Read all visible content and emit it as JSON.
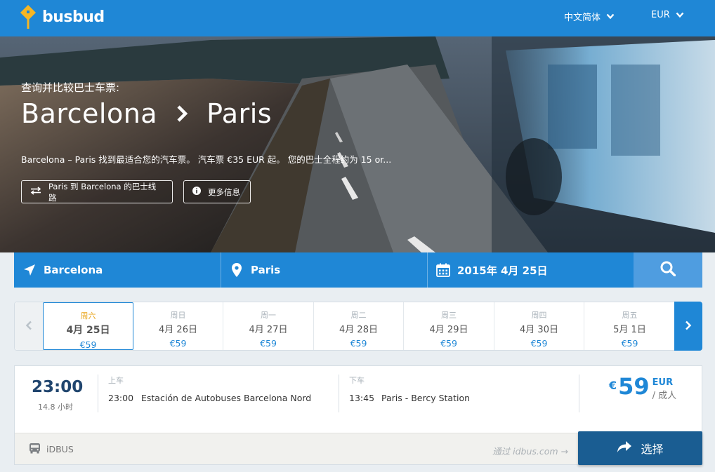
{
  "brand": {
    "name": "busbud",
    "pin_color": "#f6b624"
  },
  "nav": {
    "language": "中文简体",
    "currency": "EUR"
  },
  "hero": {
    "subtitle": "查询并比较巴士车票:",
    "origin": "Barcelona",
    "destination": "Paris",
    "description": "Barcelona – Paris 找到最适合您的汽车票。 汽车票 €35 EUR 起。 您的巴士全程约为 15 or...",
    "reverse_route_label": "Paris 到 Barcelona 的巴士线路",
    "more_info_label": "更多信息"
  },
  "search": {
    "origin": "Barcelona",
    "destination": "Paris",
    "date": "2015年 4月 25日",
    "accent": "#1f87d6"
  },
  "dates": [
    {
      "dow": "周六",
      "date": "4月 25日",
      "price": "€59",
      "active": true
    },
    {
      "dow": "周日",
      "date": "4月 26日",
      "price": "€59",
      "active": false
    },
    {
      "dow": "周一",
      "date": "4月 27日",
      "price": "€59",
      "active": false
    },
    {
      "dow": "周二",
      "date": "4月 28日",
      "price": "€59",
      "active": false
    },
    {
      "dow": "周三",
      "date": "4月 29日",
      "price": "€59",
      "active": false
    },
    {
      "dow": "周四",
      "date": "4月 30日",
      "price": "€59",
      "active": false
    },
    {
      "dow": "周五",
      "date": "5月 1日",
      "price": "€59",
      "active": false
    }
  ],
  "result": {
    "departure_time": "23:00",
    "duration": "14.8 小时",
    "boarding_label": "上车",
    "boarding_time": "23:00",
    "boarding_place": "Estación de Autobuses Barcelona Nord",
    "alighting_label": "下车",
    "alighting_time": "13:45",
    "alighting_place": "Paris - Bercy Station",
    "price_currency_symbol": "€",
    "price_amount": "59",
    "price_currency": "EUR",
    "price_per": "/ 成人",
    "operator": "iDBUS",
    "via": "通过 idbus.com →",
    "select_label": "选择"
  }
}
